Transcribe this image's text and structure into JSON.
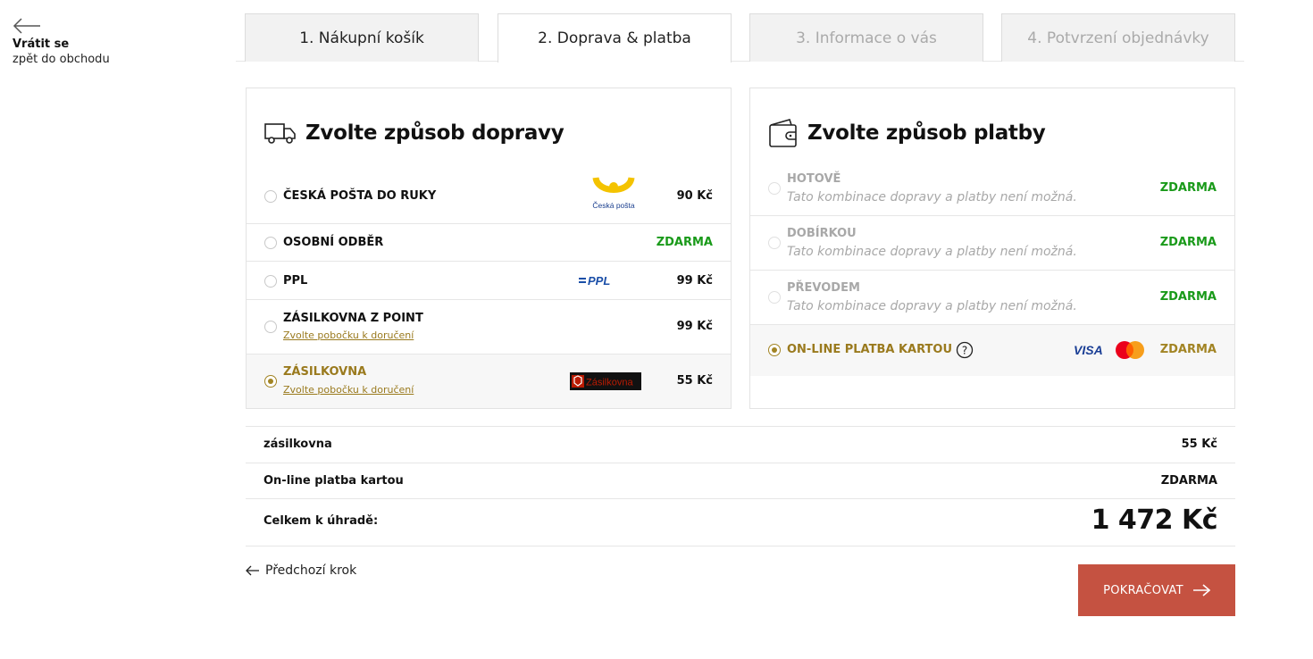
{
  "back": {
    "title": "Vrátit se",
    "subtitle": "zpět do obchodu"
  },
  "tabs": [
    {
      "label": "1. Nákupní košík",
      "state": "done"
    },
    {
      "label": "2. Doprava & platba",
      "state": "active"
    },
    {
      "label": "3. Informace o vás",
      "state": "disabled"
    },
    {
      "label": "4. Potvrzení objednávky",
      "state": "disabled"
    }
  ],
  "shipping": {
    "title": "Zvolte způsob dopravy",
    "options": [
      {
        "label": "ČESKÁ POŠTA DO RUKY",
        "price": "90 Kč",
        "logo": "ceska-posta-logo",
        "logo_text": "Česká pošta",
        "selected": false
      },
      {
        "label": "OSOBNÍ ODBĚR",
        "price": "ZDARMA",
        "selected": false
      },
      {
        "label": "PPL",
        "price": "99 Kč",
        "logo": "ppl-logo",
        "logo_text": "PPL",
        "selected": false
      },
      {
        "label": "ZÁSILKOVNA Z POINT",
        "link": "Zvolte pobočku k doručení",
        "price": "99 Kč",
        "selected": false
      },
      {
        "label": "ZÁSILKOVNA",
        "link": "Zvolte pobočku k doručení",
        "price": "55 Kč",
        "logo": "zasilkovna-logo",
        "logo_text": "Zásilkovna",
        "selected": true
      }
    ]
  },
  "payment": {
    "title": "Zvolte způsob platby",
    "options": [
      {
        "label": "HOTOVĚ",
        "note": "Tato kombinace dopravy a platby není možná.",
        "price": "ZDARMA",
        "disabled": true
      },
      {
        "label": "DOBÍRKOU",
        "note": "Tato kombinace dopravy a platby není možná.",
        "price": "ZDARMA",
        "disabled": true
      },
      {
        "label": "PŘEVODEM",
        "note": "Tato kombinace dopravy a platby není možná.",
        "price": "ZDARMA",
        "disabled": true
      },
      {
        "label": "ON-LINE PLATBA KARTOU",
        "price": "ZDARMA",
        "selected": true,
        "card_logos": [
          "VISA",
          "mastercard"
        ]
      }
    ]
  },
  "summary": {
    "shipping_label": "zásilkovna",
    "shipping_value": "55 Kč",
    "payment_label": "On-line platba kartou",
    "payment_value": "ZDARMA",
    "total_label": "Celkem k úhradě:",
    "total_value": "1 472 Kč"
  },
  "footer": {
    "prev_label": "Předchozí krok",
    "continue_label": "POKRAČOVAT"
  },
  "colors": {
    "accent_gold": "#9a7a1e",
    "free_green": "#1a9a1a",
    "cta_red": "#c55241"
  }
}
